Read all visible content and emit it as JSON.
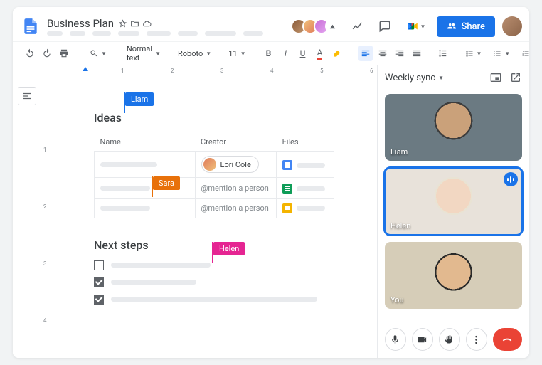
{
  "header": {
    "doc_title": "Business Plan",
    "share_label": "Share"
  },
  "toolbar": {
    "style_label": "Normal text",
    "font_label": "Roboto",
    "size_label": "11"
  },
  "doc": {
    "ideas_heading": "Ideas",
    "columns": {
      "name": "Name",
      "creator": "Creator",
      "files": "Files"
    },
    "rows": [
      {
        "creator_type": "chip",
        "creator": "Lori Cole",
        "file": "docs"
      },
      {
        "creator_type": "mention",
        "creator": "@mention a person",
        "file": "sheets"
      },
      {
        "creator_type": "mention",
        "creator": "@mention a person",
        "file": "slides"
      }
    ],
    "next_heading": "Next steps",
    "checklist": [
      {
        "checked": false
      },
      {
        "checked": true
      },
      {
        "checked": true
      }
    ],
    "cursors": {
      "liam": "Liam",
      "sara": "Sara",
      "helen": "Helen"
    }
  },
  "meet": {
    "title": "Weekly sync",
    "tiles": [
      {
        "name": "Liam",
        "speaking": false
      },
      {
        "name": "Helen",
        "speaking": true
      },
      {
        "name": "You",
        "speaking": false
      }
    ]
  },
  "ruler_numbers": [
    "1",
    "2",
    "3",
    "4",
    "5",
    "6"
  ],
  "vruler_numbers": [
    "1",
    "2",
    "3",
    "4"
  ]
}
